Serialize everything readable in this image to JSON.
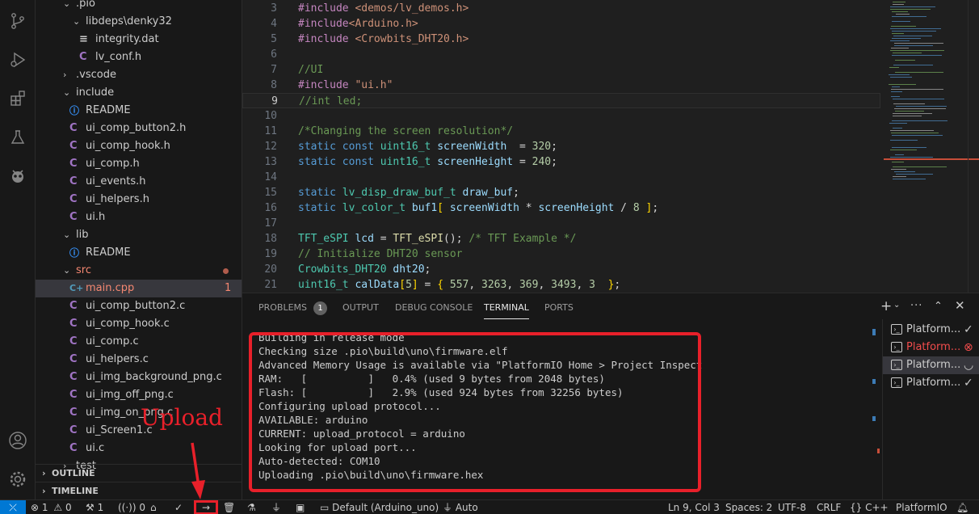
{
  "explorer": {
    "items": [
      {
        "label": ".pio",
        "indent": 1,
        "kind": "folder-open"
      },
      {
        "label": "libdeps\\denky32",
        "indent": 2,
        "kind": "folder-open"
      },
      {
        "label": "integrity.dat",
        "indent": 3,
        "kind": "dat"
      },
      {
        "label": "lv_conf.h",
        "indent": 3,
        "kind": "c"
      },
      {
        "label": ".vscode",
        "indent": 1,
        "kind": "folder-closed"
      },
      {
        "label": "include",
        "indent": 1,
        "kind": "folder-open"
      },
      {
        "label": "README",
        "indent": 2,
        "kind": "info"
      },
      {
        "label": "ui_comp_button2.h",
        "indent": 2,
        "kind": "c"
      },
      {
        "label": "ui_comp_hook.h",
        "indent": 2,
        "kind": "c"
      },
      {
        "label": "ui_comp.h",
        "indent": 2,
        "kind": "c"
      },
      {
        "label": "ui_events.h",
        "indent": 2,
        "kind": "c"
      },
      {
        "label": "ui_helpers.h",
        "indent": 2,
        "kind": "c"
      },
      {
        "label": "ui.h",
        "indent": 2,
        "kind": "c"
      },
      {
        "label": "lib",
        "indent": 1,
        "kind": "folder-open"
      },
      {
        "label": "README",
        "indent": 2,
        "kind": "info"
      },
      {
        "label": "src",
        "indent": 1,
        "kind": "folder-open",
        "modified": true
      },
      {
        "label": "main.cpp",
        "indent": 2,
        "kind": "cpp",
        "selected": true,
        "badge": "1"
      },
      {
        "label": "ui_comp_button2.c",
        "indent": 2,
        "kind": "c"
      },
      {
        "label": "ui_comp_hook.c",
        "indent": 2,
        "kind": "c"
      },
      {
        "label": "ui_comp.c",
        "indent": 2,
        "kind": "c"
      },
      {
        "label": "ui_helpers.c",
        "indent": 2,
        "kind": "c"
      },
      {
        "label": "ui_img_background_png.c",
        "indent": 2,
        "kind": "c"
      },
      {
        "label": "ui_img_off_png.c",
        "indent": 2,
        "kind": "c"
      },
      {
        "label": "ui_img_on_png.c",
        "indent": 2,
        "kind": "c"
      },
      {
        "label": "ui_Screen1.c",
        "indent": 2,
        "kind": "c"
      },
      {
        "label": "ui.c",
        "indent": 2,
        "kind": "c"
      },
      {
        "label": "test",
        "indent": 1,
        "kind": "folder-closed"
      }
    ],
    "outline_label": "OUTLINE",
    "timeline_label": "TIMELINE"
  },
  "editor": {
    "lines": [
      {
        "n": "3",
        "tokens": [
          [
            "inc",
            "#include "
          ],
          [
            "str",
            "<demos/lv_demos.h>"
          ]
        ]
      },
      {
        "n": "4",
        "tokens": [
          [
            "inc",
            "#include"
          ],
          [
            "str",
            "<Arduino.h>"
          ]
        ]
      },
      {
        "n": "5",
        "tokens": [
          [
            "inc",
            "#include "
          ],
          [
            "str",
            "<Crowbits_DHT20.h>"
          ]
        ]
      },
      {
        "n": "6",
        "tokens": []
      },
      {
        "n": "7",
        "tokens": [
          [
            "cm",
            "//UI"
          ]
        ]
      },
      {
        "n": "8",
        "tokens": [
          [
            "inc",
            "#include "
          ],
          [
            "str",
            "\"ui.h\""
          ]
        ]
      },
      {
        "n": "9",
        "tokens": [
          [
            "cm",
            "//int led;"
          ]
        ],
        "current": true
      },
      {
        "n": "10",
        "tokens": []
      },
      {
        "n": "11",
        "tokens": [
          [
            "cm",
            "/*Changing the screen resolution*/"
          ]
        ]
      },
      {
        "n": "12",
        "tokens": [
          [
            "kw",
            "static "
          ],
          [
            "kw",
            "const "
          ],
          [
            "ty",
            "uint16_t "
          ],
          [
            "var",
            "screenWidth"
          ],
          [
            "pl",
            "  = "
          ],
          [
            "num",
            "320"
          ],
          [
            "pl",
            ";"
          ]
        ]
      },
      {
        "n": "13",
        "tokens": [
          [
            "kw",
            "static "
          ],
          [
            "kw",
            "const "
          ],
          [
            "ty",
            "uint16_t "
          ],
          [
            "var",
            "screenHeight"
          ],
          [
            "pl",
            " = "
          ],
          [
            "num",
            "240"
          ],
          [
            "pl",
            ";"
          ]
        ]
      },
      {
        "n": "14",
        "tokens": []
      },
      {
        "n": "15",
        "tokens": [
          [
            "kw",
            "static "
          ],
          [
            "ty",
            "lv_disp_draw_buf_t "
          ],
          [
            "var",
            "draw_buf"
          ],
          [
            "pl",
            ";"
          ]
        ]
      },
      {
        "n": "16",
        "tokens": [
          [
            "kw",
            "static "
          ],
          [
            "ty",
            "lv_color_t "
          ],
          [
            "var",
            "buf1"
          ],
          [
            "br",
            "[ "
          ],
          [
            "var",
            "screenWidth"
          ],
          [
            "pl",
            " * "
          ],
          [
            "var",
            "screenHeight"
          ],
          [
            "pl",
            " / "
          ],
          [
            "num",
            "8"
          ],
          [
            "br",
            " ]"
          ],
          [
            "pl",
            ";"
          ]
        ]
      },
      {
        "n": "17",
        "tokens": []
      },
      {
        "n": "18",
        "tokens": [
          [
            "ty",
            "TFT_eSPI "
          ],
          [
            "var",
            "lcd"
          ],
          [
            "pl",
            " = "
          ],
          [
            "fn",
            "TFT_eSPI"
          ],
          [
            "pl",
            "(); "
          ],
          [
            "cm",
            "/* TFT Example */"
          ]
        ]
      },
      {
        "n": "19",
        "tokens": [
          [
            "cm",
            "// Initialize DHT20 sensor"
          ]
        ]
      },
      {
        "n": "20",
        "tokens": [
          [
            "ty",
            "Crowbits_DHT20 "
          ],
          [
            "var",
            "dht20"
          ],
          [
            "pl",
            ";"
          ]
        ]
      },
      {
        "n": "21",
        "tokens": [
          [
            "ty",
            "uint16_t "
          ],
          [
            "var",
            "calData"
          ],
          [
            "br",
            "["
          ],
          [
            "num",
            "5"
          ],
          [
            "br",
            "]"
          ],
          [
            "pl",
            " = "
          ],
          [
            "br",
            "{ "
          ],
          [
            "num",
            "557"
          ],
          [
            "pl",
            ", "
          ],
          [
            "num",
            "3263"
          ],
          [
            "pl",
            ", "
          ],
          [
            "num",
            "369"
          ],
          [
            "pl",
            ", "
          ],
          [
            "num",
            "3493"
          ],
          [
            "pl",
            ", "
          ],
          [
            "num",
            "3"
          ],
          [
            "br",
            "  }"
          ],
          [
            "pl",
            ";"
          ]
        ]
      }
    ]
  },
  "panel": {
    "tabs": [
      {
        "label": "PROBLEMS",
        "badge": "1"
      },
      {
        "label": "OUTPUT"
      },
      {
        "label": "DEBUG CONSOLE"
      },
      {
        "label": "TERMINAL",
        "active": true
      },
      {
        "label": "PORTS"
      }
    ],
    "terminal_lines": [
      "Building in release mode",
      "Checking size .pio\\build\\uno\\firmware.elf",
      "Advanced Memory Usage is available via \"PlatformIO Home > Project Inspect\"",
      "RAM:   [          ]   0.4% (used 9 bytes from 2048 bytes)",
      "Flash: [          ]   2.9% (used 924 bytes from 32256 bytes)",
      "Configuring upload protocol...",
      "AVAILABLE: arduino",
      "CURRENT: upload_protocol = arduino",
      "Looking for upload port...",
      "Auto-detected: COM10",
      "Uploading .pio\\build\\uno\\firmware.hex"
    ],
    "terminals": [
      {
        "label": "Platform...",
        "state": "check-icon",
        "color": "#cccccc"
      },
      {
        "label": "Platform...",
        "state": "error-icon",
        "color": "#f14c4c"
      },
      {
        "label": "Platform...",
        "state": "loading-icon",
        "color": "#cccccc",
        "selected": true
      },
      {
        "label": "Platform...",
        "state": "check-icon",
        "color": "#cccccc"
      }
    ]
  },
  "status": {
    "errors": "1",
    "warnings": "0",
    "tools": "1",
    "ports": "0",
    "env": "Default (Arduino_uno)",
    "auto": "Auto",
    "position": "Ln 9, Col 3",
    "spaces": "Spaces: 2",
    "encoding": "UTF-8",
    "eol": "CRLF",
    "language": "C++",
    "platformio": "PlatformIO"
  },
  "annotation": {
    "label": "Upload",
    "color": "#e8202a"
  }
}
